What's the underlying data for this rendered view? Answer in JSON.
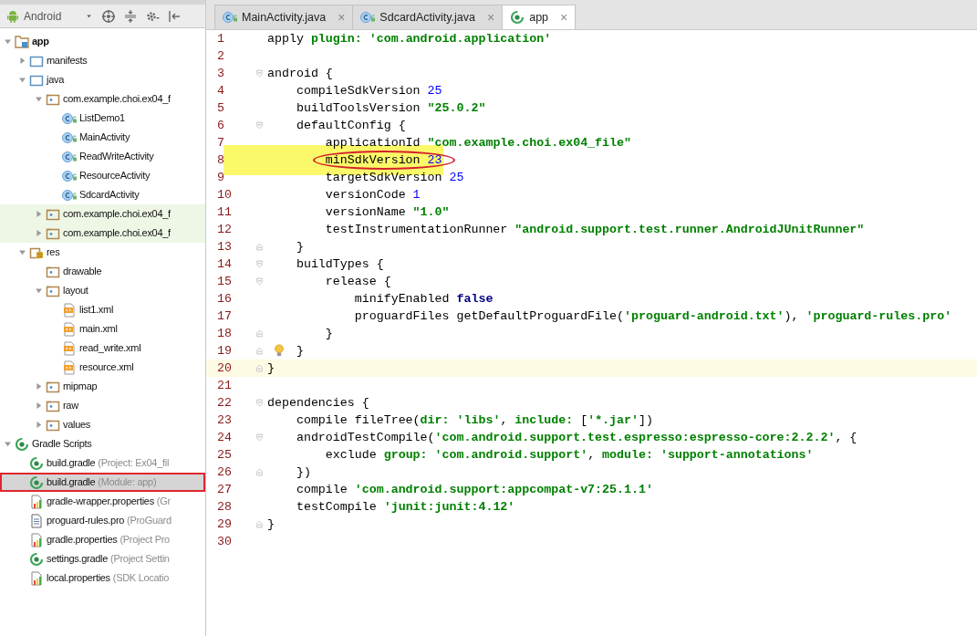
{
  "toolbar": {
    "view_selector": "Android"
  },
  "project_tree": [
    {
      "label": "app",
      "kind": "module",
      "expanded": true,
      "selected": false,
      "children": [
        {
          "label": "manifests",
          "kind": "folder",
          "expanded": false,
          "selected": false
        },
        {
          "label": "java",
          "kind": "folder",
          "expanded": true,
          "selected": false,
          "children": [
            {
              "label": "com.example.choi.ex04_f",
              "kind": "package",
              "expanded": true,
              "selected": false,
              "children": [
                {
                  "label": "ListDemo1",
                  "kind": "class",
                  "selected": false
                },
                {
                  "label": "MainActivity",
                  "kind": "class",
                  "selected": false
                },
                {
                  "label": "ReadWriteActivity",
                  "kind": "class",
                  "selected": false
                },
                {
                  "label": "ResourceActivity",
                  "kind": "class",
                  "selected": false
                },
                {
                  "label": "SdcardActivity",
                  "kind": "class",
                  "selected": false
                }
              ]
            },
            {
              "label": "com.example.choi.ex04_f",
              "kind": "package",
              "expanded": false,
              "selected": false,
              "test": true
            },
            {
              "label": "com.example.choi.ex04_f",
              "kind": "package",
              "expanded": false,
              "selected": false,
              "test": true
            }
          ]
        },
        {
          "label": "res",
          "kind": "resources",
          "expanded": true,
          "selected": false,
          "children": [
            {
              "label": "drawable",
              "kind": "package",
              "selected": false
            },
            {
              "label": "layout",
              "kind": "package",
              "expanded": true,
              "selected": false,
              "children": [
                {
                  "label": "list1.xml",
                  "kind": "xml",
                  "selected": false
                },
                {
                  "label": "main.xml",
                  "kind": "xml",
                  "selected": false
                },
                {
                  "label": "read_write.xml",
                  "kind": "xml",
                  "selected": false
                },
                {
                  "label": "resource.xml",
                  "kind": "xml",
                  "selected": false
                }
              ]
            },
            {
              "label": "mipmap",
              "kind": "package",
              "expanded": false,
              "selected": false
            },
            {
              "label": "raw",
              "kind": "package",
              "expanded": false,
              "selected": false
            },
            {
              "label": "values",
              "kind": "package",
              "expanded": false,
              "selected": false
            }
          ]
        }
      ]
    },
    {
      "label": "Gradle Scripts",
      "kind": "gradle",
      "expanded": true,
      "selected": false,
      "children": [
        {
          "label": "build.gradle",
          "note": "(Project: Ex04_fil",
          "kind": "gradle",
          "selected": false
        },
        {
          "label": "build.gradle",
          "note": "(Module: app)",
          "kind": "gradle",
          "selected": true
        },
        {
          "label": "gradle-wrapper.properties",
          "note": "(Gr",
          "kind": "properties",
          "selected": false
        },
        {
          "label": "proguard-rules.pro",
          "note": "(ProGuard",
          "kind": "text",
          "selected": false
        },
        {
          "label": "gradle.properties",
          "note": "(Project Pro",
          "kind": "properties",
          "selected": false
        },
        {
          "label": "settings.gradle",
          "note": "(Project Settin",
          "kind": "gradle",
          "selected": false
        },
        {
          "label": "local.properties",
          "note": "(SDK Locatio",
          "kind": "properties",
          "selected": false
        }
      ]
    }
  ],
  "tabs": [
    {
      "label": "MainActivity.java",
      "kind": "class",
      "selected": false,
      "close": "×"
    },
    {
      "label": "SdcardActivity.java",
      "kind": "class",
      "selected": false,
      "close": "×"
    },
    {
      "label": "app",
      "kind": "gradle",
      "selected": true,
      "close": "×"
    }
  ],
  "code_lines": [
    {
      "number": "1",
      "tokens": [
        {
          "text": "apply ",
          "kind": "plain"
        },
        {
          "text": "plugin: ",
          "kind": "key"
        },
        {
          "text": "'com.android.application'",
          "kind": "string"
        }
      ]
    },
    {
      "number": "2"
    },
    {
      "number": "3",
      "fold_start": true,
      "tokens": [
        {
          "text": "android {",
          "kind": "plain"
        }
      ]
    },
    {
      "number": "4",
      "tokens": [
        {
          "text": "    compileSdkVersion ",
          "kind": "plain"
        },
        {
          "text": "25",
          "kind": "number"
        }
      ]
    },
    {
      "number": "5",
      "tokens": [
        {
          "text": "    buildToolsVersion ",
          "kind": "plain"
        },
        {
          "text": "\"25.0.2\"",
          "kind": "string"
        }
      ]
    },
    {
      "number": "6",
      "fold_start": true,
      "tokens": [
        {
          "text": "    defaultConfig {",
          "kind": "plain"
        }
      ]
    },
    {
      "number": "7",
      "tokens": [
        {
          "text": "        applicationId ",
          "kind": "plain"
        },
        {
          "text": "\"com.example.choi.ex04_file\"",
          "kind": "string"
        }
      ]
    },
    {
      "number": "8",
      "highlighted": true,
      "circled": true,
      "tokens": [
        {
          "text": "        minSdkVersion ",
          "kind": "plain"
        },
        {
          "text": "23",
          "kind": "number"
        }
      ]
    },
    {
      "number": "9",
      "tokens": [
        {
          "text": "        targetSdkVersion ",
          "kind": "plain"
        },
        {
          "text": "25",
          "kind": "number"
        }
      ]
    },
    {
      "number": "10",
      "tokens": [
        {
          "text": "        versionCode ",
          "kind": "plain"
        },
        {
          "text": "1",
          "kind": "number"
        }
      ]
    },
    {
      "number": "11",
      "tokens": [
        {
          "text": "        versionName ",
          "kind": "plain"
        },
        {
          "text": "\"1.0\"",
          "kind": "string"
        }
      ]
    },
    {
      "number": "12",
      "tokens": [
        {
          "text": "        testInstrumentationRunner ",
          "kind": "plain"
        },
        {
          "text": "\"android.support.test.runner.AndroidJUnitRunner\"",
          "kind": "string"
        }
      ]
    },
    {
      "number": "13",
      "fold_end": true,
      "tokens": [
        {
          "text": "    }",
          "kind": "plain"
        }
      ]
    },
    {
      "number": "14",
      "fold_start": true,
      "tokens": [
        {
          "text": "    buildTypes {",
          "kind": "plain"
        }
      ]
    },
    {
      "number": "15",
      "fold_start": true,
      "tokens": [
        {
          "text": "        release {",
          "kind": "plain"
        }
      ]
    },
    {
      "number": "16",
      "tokens": [
        {
          "text": "            minifyEnabled ",
          "kind": "plain"
        },
        {
          "text": "false",
          "kind": "keyword"
        }
      ]
    },
    {
      "number": "17",
      "tokens": [
        {
          "text": "            proguardFiles getDefaultProguardFile(",
          "kind": "plain"
        },
        {
          "text": "'proguard-android.txt'",
          "kind": "string"
        },
        {
          "text": "), ",
          "kind": "plain"
        },
        {
          "text": "'proguard-rules.pro'",
          "kind": "string"
        }
      ]
    },
    {
      "number": "18",
      "fold_end": true,
      "tokens": [
        {
          "text": "        }",
          "kind": "plain"
        }
      ]
    },
    {
      "number": "19",
      "fold_end": true,
      "bulb": true,
      "tokens": [
        {
          "text": "    }",
          "kind": "plain"
        }
      ]
    },
    {
      "number": "20",
      "fold_end": true,
      "current": true,
      "tokens": [
        {
          "text": "}",
          "kind": "plain"
        }
      ]
    },
    {
      "number": "21"
    },
    {
      "number": "22",
      "fold_start": true,
      "tokens": [
        {
          "text": "dependencies {",
          "kind": "plain"
        }
      ]
    },
    {
      "number": "23",
      "tokens": [
        {
          "text": "    compile fileTree(",
          "kind": "plain"
        },
        {
          "text": "dir: ",
          "kind": "key"
        },
        {
          "text": "'libs'",
          "kind": "string"
        },
        {
          "text": ", ",
          "kind": "plain"
        },
        {
          "text": "include: ",
          "kind": "key"
        },
        {
          "text": "[",
          "kind": "plain"
        },
        {
          "text": "'*.jar'",
          "kind": "string"
        },
        {
          "text": "])",
          "kind": "plain"
        }
      ]
    },
    {
      "number": "24",
      "fold_start": true,
      "tokens": [
        {
          "text": "    androidTestCompile(",
          "kind": "plain"
        },
        {
          "text": "'com.android.support.test.espresso:espresso-core:2.2.2'",
          "kind": "string"
        },
        {
          "text": ", {",
          "kind": "plain"
        }
      ]
    },
    {
      "number": "25",
      "tokens": [
        {
          "text": "        exclude ",
          "kind": "plain"
        },
        {
          "text": "group: ",
          "kind": "key"
        },
        {
          "text": "'com.android.support'",
          "kind": "string"
        },
        {
          "text": ", ",
          "kind": "plain"
        },
        {
          "text": "module: ",
          "kind": "key"
        },
        {
          "text": "'support-annotations'",
          "kind": "string"
        }
      ]
    },
    {
      "number": "26",
      "fold_end": true,
      "tokens": [
        {
          "text": "    })",
          "kind": "plain"
        }
      ]
    },
    {
      "number": "27",
      "tokens": [
        {
          "text": "    compile ",
          "kind": "plain"
        },
        {
          "text": "'com.android.support:appcompat-v7:25.1.1'",
          "kind": "string"
        }
      ]
    },
    {
      "number": "28",
      "tokens": [
        {
          "text": "    testCompile ",
          "kind": "plain"
        },
        {
          "text": "'junit:junit:4.12'",
          "kind": "string"
        }
      ]
    },
    {
      "number": "29",
      "fold_end": true,
      "tokens": [
        {
          "text": "}",
          "kind": "plain"
        }
      ]
    },
    {
      "number": "30"
    }
  ]
}
